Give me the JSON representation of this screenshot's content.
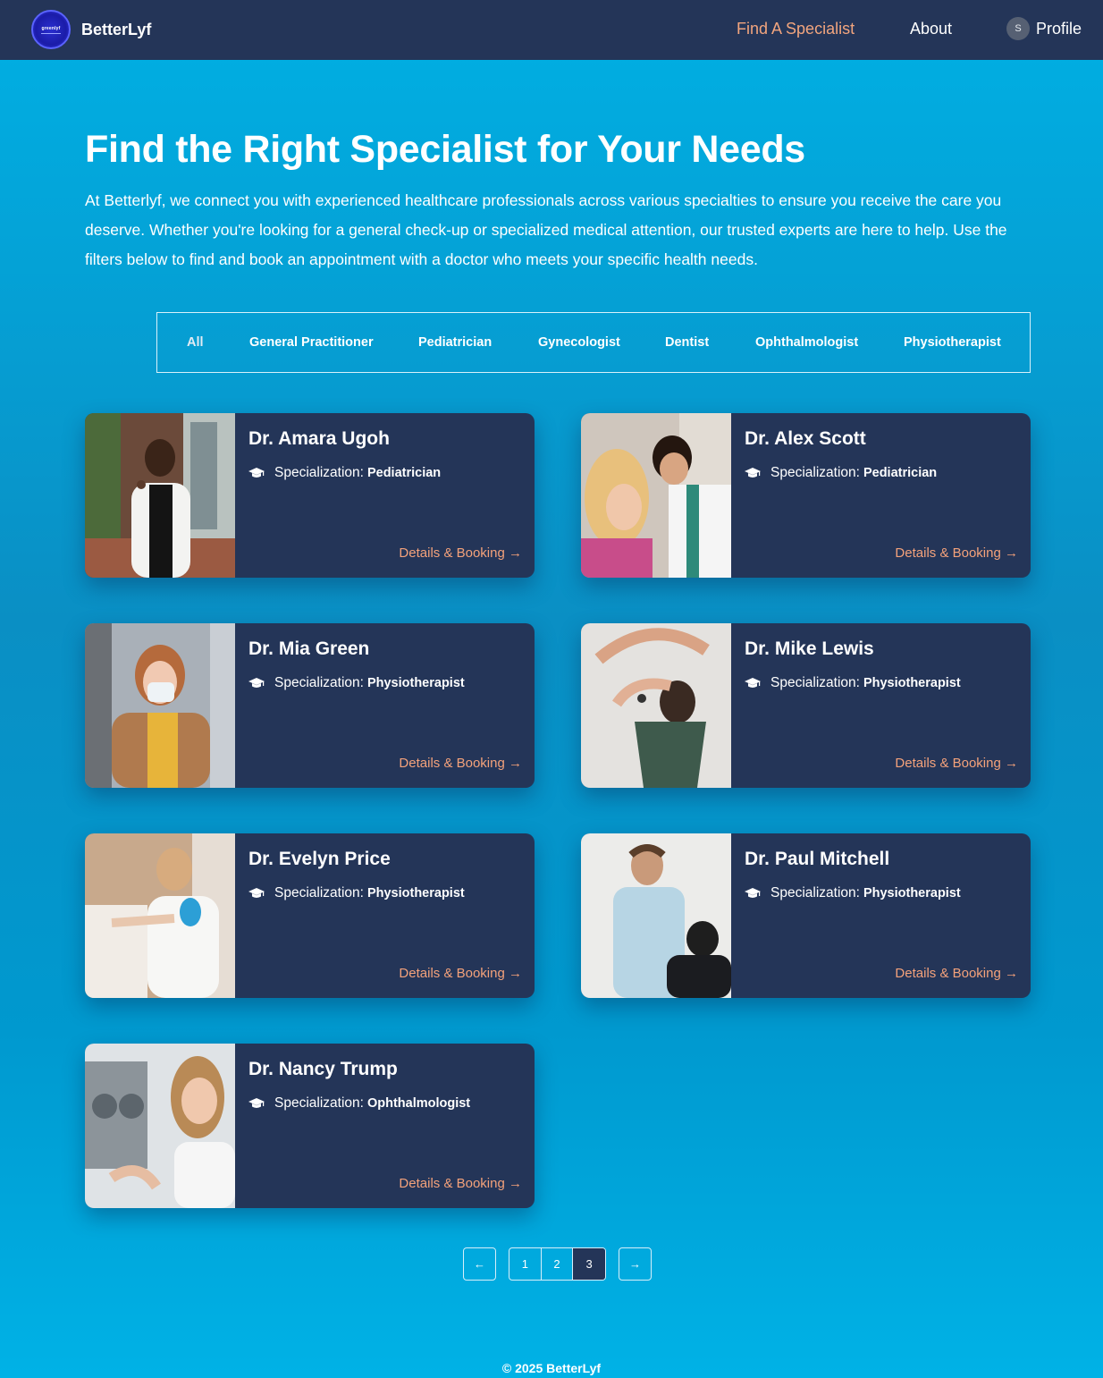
{
  "nav": {
    "logo_text": "greenlyf",
    "brand": "BetterLyf",
    "links": {
      "find": "Find A Specialist",
      "about": "About",
      "profile_initial": "S",
      "profile": "Profile"
    }
  },
  "hero": {
    "title": "Find the Right Specialist for Your Needs",
    "description": "At Betterlyf, we connect you with experienced healthcare professionals across various specialties to ensure you receive the care you deserve. Whether you're looking for a general check-up or specialized medical attention, our trusted experts are here to help. Use the filters below to find and book an appointment with a doctor who meets your specific health needs."
  },
  "filters": [
    "All",
    "General Practitioner",
    "Pediatrician",
    "Gynecologist",
    "Dentist",
    "Ophthalmologist",
    "Physiotherapist"
  ],
  "spec_prefix": "Specialization:",
  "details_label": "Details & Booking →",
  "doctors": [
    {
      "name": "Dr. Amara Ugoh",
      "specialization": "Pediatrician"
    },
    {
      "name": "Dr. Alex Scott",
      "specialization": "Pediatrician"
    },
    {
      "name": "Dr. Mia Green",
      "specialization": "Physiotherapist"
    },
    {
      "name": "Dr. Mike Lewis",
      "specialization": "Physiotherapist"
    },
    {
      "name": "Dr. Evelyn Price",
      "specialization": "Physiotherapist"
    },
    {
      "name": "Dr. Paul Mitchell",
      "specialization": "Physiotherapist"
    },
    {
      "name": "Dr. Nancy Trump",
      "specialization": "Ophthalmologist"
    }
  ],
  "pagination": {
    "prev": "←",
    "next": "→",
    "pages": [
      "1",
      "2",
      "3"
    ],
    "current": "3"
  },
  "footer": "© 2025  BetterLyf",
  "colors": {
    "navbar": "#243558",
    "accent": "#f4a27b",
    "background": "#0a9ad0"
  }
}
